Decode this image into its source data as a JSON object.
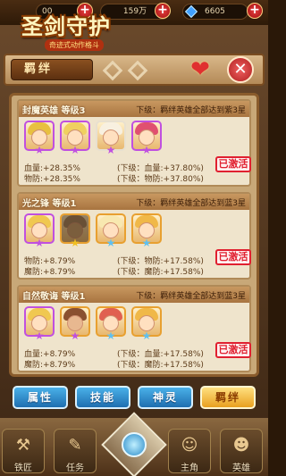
{
  "resources": {
    "stamina": "00",
    "gold": "159万",
    "gems": "6605"
  },
  "logo": {
    "title": "圣剑守护",
    "subtitle": "奇迹式动作格斗"
  },
  "header": {
    "title": "羁绊"
  },
  "bonds": [
    {
      "name": "封魔英雄 等级3",
      "requirement": "下级：羁绊英雄全部达到紫3星",
      "stats": [
        "血量:+28.35%",
        "物防:+28.35%"
      ],
      "next": [
        "(下级：血量:+37.80%)",
        "(下级：物防:+37.80%)"
      ],
      "status": "已激活"
    },
    {
      "name": "光之锋 等级1",
      "requirement": "下级：羁绊英雄全部达到蓝3星",
      "stats": [
        "物防:+8.79%",
        "魔防:+8.79%"
      ],
      "next": [
        "(下级：物防:+17.58%)",
        "(下级：魔防:+17.58%)"
      ],
      "status": "已激活"
    },
    {
      "name": "自然敬诲 等级1",
      "requirement": "下级：羁绊英雄全部达到蓝3星",
      "stats": [
        "血量:+8.79%",
        "魔防:+8.79%"
      ],
      "next": [
        "(下级：血量:+17.58%)",
        "(下级：魔防:+17.58%)"
      ],
      "status": "已激活"
    }
  ],
  "tabs": [
    "属性",
    "技能",
    "神灵",
    "羁绊"
  ],
  "active_tab": "羁绊",
  "nav": {
    "n1": "铁匠",
    "n2": "任务",
    "n3": "主角",
    "n4": "英雄"
  },
  "colors": {
    "accent_blue": "#1e6eb0",
    "active_tab": "#e8a020",
    "badge_red": "#e02030"
  }
}
